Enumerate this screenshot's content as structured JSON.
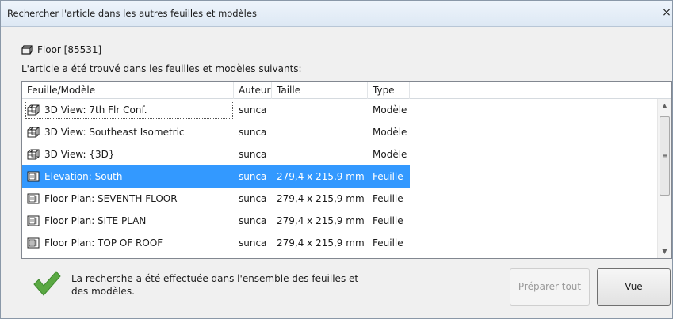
{
  "window": {
    "title": "Rechercher l'article dans les autres feuilles et modèles",
    "close_glyph": "×"
  },
  "element": {
    "icon": "floor-element-icon",
    "name": "Floor [85531]"
  },
  "found_label": "L'article a été trouvé dans les feuilles et modèles suivants:",
  "table": {
    "columns": [
      "Feuille/Modèle",
      "Auteur",
      "Taille",
      "Type"
    ],
    "rows": [
      {
        "icon": "3d-view-icon",
        "name": "3D View: 7th Flr Conf.",
        "author": "sunca",
        "size": "",
        "type": "Modèle",
        "selected": false,
        "focused": true
      },
      {
        "icon": "3d-view-icon",
        "name": "3D View: Southeast Isometric",
        "author": "sunca",
        "size": "",
        "type": "Modèle",
        "selected": false,
        "focused": false
      },
      {
        "icon": "3d-view-icon",
        "name": "3D View: {3D}",
        "author": "sunca",
        "size": "",
        "type": "Modèle",
        "selected": false,
        "focused": false
      },
      {
        "icon": "sheet-icon",
        "name": "Elevation: South",
        "author": "sunca",
        "size": "279,4 x 215,9 mm",
        "type": "Feuille",
        "selected": true,
        "focused": false
      },
      {
        "icon": "sheet-icon",
        "name": "Floor Plan: SEVENTH FLOOR",
        "author": "sunca",
        "size": "279,4 x 215,9 mm",
        "type": "Feuille",
        "selected": false,
        "focused": false
      },
      {
        "icon": "sheet-icon",
        "name": "Floor Plan: SITE PLAN",
        "author": "sunca",
        "size": "279,4 x 215,9 mm",
        "type": "Feuille",
        "selected": false,
        "focused": false
      },
      {
        "icon": "sheet-icon",
        "name": "Floor Plan: TOP OF ROOF",
        "author": "sunca",
        "size": "279,4 x 215,9 mm",
        "type": "Feuille",
        "selected": false,
        "focused": false
      }
    ]
  },
  "status": {
    "icon": "checkmark-icon",
    "text": "La recherche a été effectuée dans l'ensemble des feuilles et des modèles."
  },
  "buttons": {
    "prepare_all": "Préparer tout",
    "view": "Vue"
  },
  "colors": {
    "selection": "#3399ff",
    "check_green": "#5aa843"
  }
}
